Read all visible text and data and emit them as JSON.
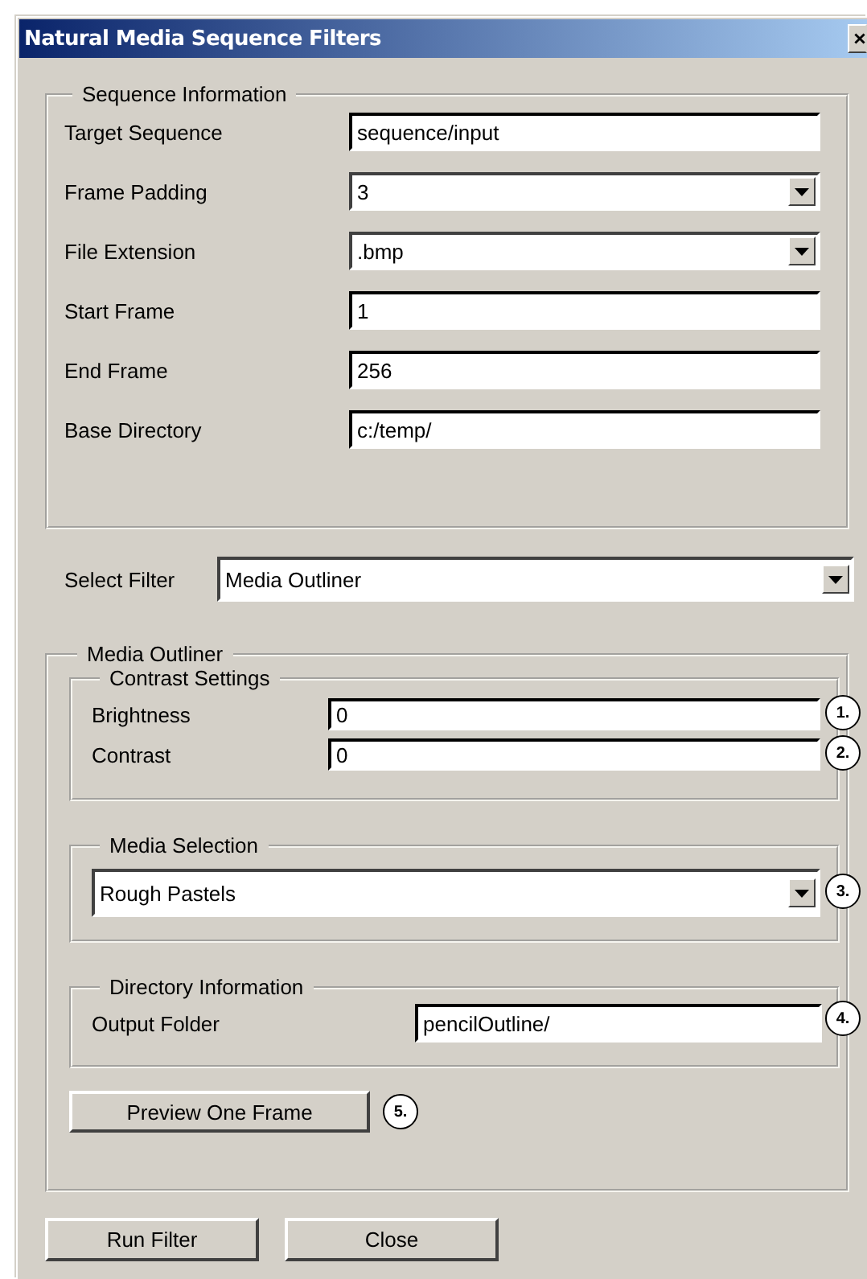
{
  "window": {
    "title": "Natural Media Sequence Filters"
  },
  "sequence_information": {
    "legend": "Sequence Information",
    "fields": [
      {
        "label": "Target Sequence",
        "value": "sequence/input",
        "kind": "text"
      },
      {
        "label": "Frame Padding",
        "value": "3",
        "kind": "dropdown"
      },
      {
        "label": "File Extension",
        "value": ".bmp",
        "kind": "dropdown"
      },
      {
        "label": "Start Frame",
        "value": "1",
        "kind": "text"
      },
      {
        "label": "End Frame",
        "value": "256",
        "kind": "text"
      },
      {
        "label": "Base Directory",
        "value": "c:/temp/",
        "kind": "text"
      }
    ]
  },
  "select_filter": {
    "label": "Select Filter",
    "value": "Media Outliner"
  },
  "media_outliner": {
    "legend": "Media Outliner",
    "contrast_settings": {
      "legend": "Contrast Settings",
      "fields": [
        {
          "label": "Brightness",
          "value": "0",
          "callout": "1."
        },
        {
          "label": "Contrast",
          "value": "0",
          "callout": "2."
        }
      ]
    },
    "media_selection": {
      "legend": "Media Selection",
      "value": "Rough Pastels",
      "callout": "3."
    },
    "directory_information": {
      "legend": "Directory Information",
      "label": "Output Folder",
      "value": "pencilOutline/",
      "callout": "4."
    },
    "preview_button": {
      "label": "Preview One Frame",
      "callout": "5."
    }
  },
  "buttons": [
    "Run Filter",
    "Close"
  ]
}
